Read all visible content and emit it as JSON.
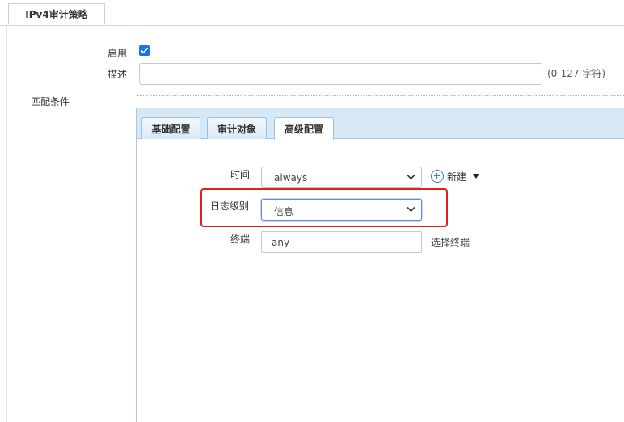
{
  "top_tab": {
    "label": "IPv4审计策略"
  },
  "form": {
    "enable_label": "启用",
    "enabled": true,
    "desc_label": "描述",
    "desc_value": "",
    "desc_hint": "(0-127 字符)",
    "match_label": "匹配条件"
  },
  "panel": {
    "tabs": [
      {
        "label": "基础配置",
        "active": false
      },
      {
        "label": "审计对象",
        "active": false
      },
      {
        "label": "高级配置",
        "active": true
      }
    ],
    "time_label": "时间",
    "time_value": "always",
    "new_label": "新建",
    "loglevel_label": "日志级别",
    "loglevel_value": "信息",
    "terminal_label": "终端",
    "terminal_value": "any",
    "select_terminal_link": "选择终端"
  },
  "colors": {
    "accent": "#1a73e8",
    "panel_tab_bg": "#d7e8f6",
    "highlight": "#e0201b"
  }
}
